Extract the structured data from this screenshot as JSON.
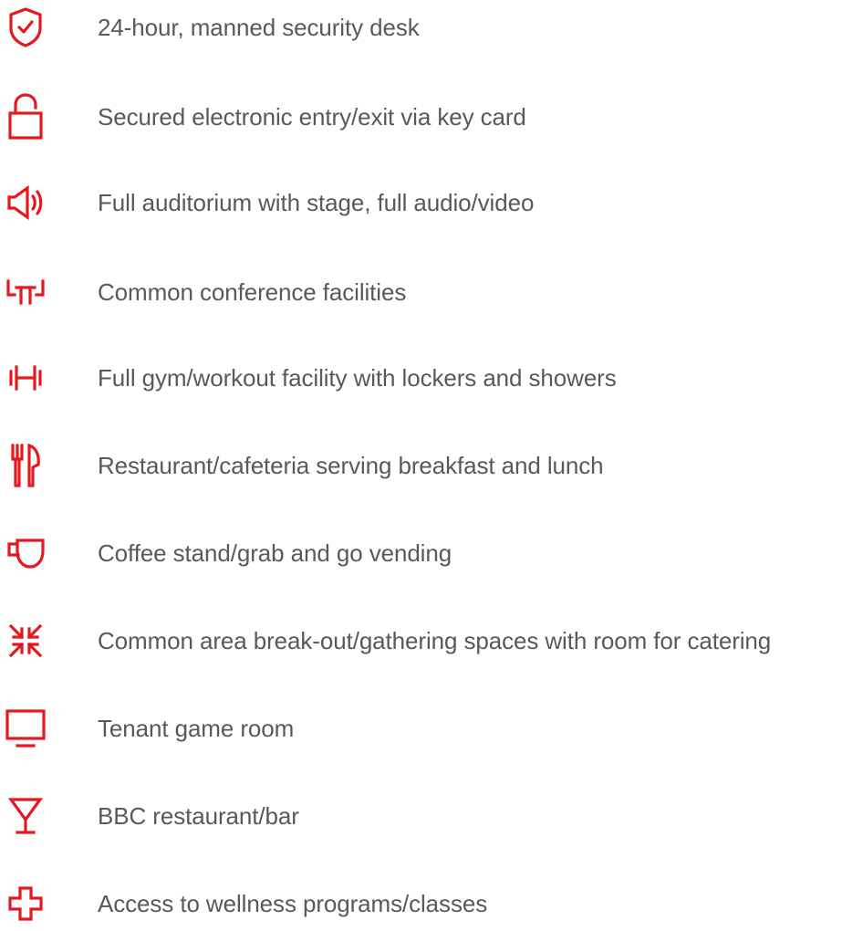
{
  "accent_color": "#e3191f",
  "text_color": "#595959",
  "amenities": [
    {
      "icon": "shield-check-icon",
      "label": "24-hour, manned security desk"
    },
    {
      "icon": "padlock-icon",
      "label": "Secured electronic entry/exit via key card"
    },
    {
      "icon": "speaker-icon",
      "label": "Full auditorium with stage, full audio/video"
    },
    {
      "icon": "conference-table-icon",
      "label": "Common conference facilities"
    },
    {
      "icon": "dumbbell-icon",
      "label": "Full gym/workout facility with lockers and showers"
    },
    {
      "icon": "fork-knife-icon",
      "label": "Restaurant/cafeteria serving breakfast and lunch"
    },
    {
      "icon": "coffee-cup-icon",
      "label": "Coffee stand/grab and go vending"
    },
    {
      "icon": "converge-arrows-icon",
      "label": "Common area break-out/gathering spaces with room for catering"
    },
    {
      "icon": "monitor-icon",
      "label": "Tenant game room"
    },
    {
      "icon": "cocktail-glass-icon",
      "label": "BBC restaurant/bar"
    },
    {
      "icon": "medical-cross-icon",
      "label": "Access to wellness programs/classes"
    }
  ]
}
